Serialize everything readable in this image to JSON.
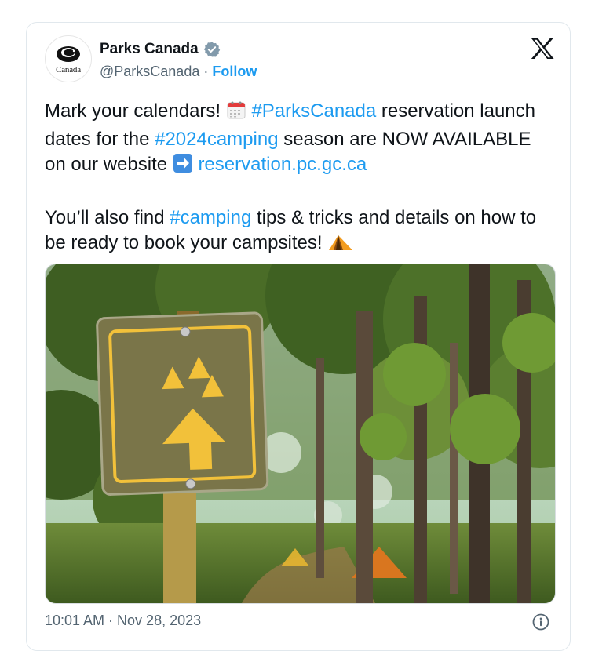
{
  "account": {
    "display_name": "Parks Canada",
    "handle": "@ParksCanada",
    "separator": " · ",
    "follow_label": "Follow",
    "verified": true,
    "avatar_wordmark": "Canada"
  },
  "tweet": {
    "line1_a": "Mark your calendars! ",
    "hashtag1": "#ParksCanada",
    "line1_b": " reservation launch dates for the ",
    "hashtag2": "#2024camping",
    "line1_c": " season are NOW AVAILABLE on our website ",
    "link": "reservation.pc.gc.ca",
    "line2_a": "You’ll also find ",
    "hashtag3": "#camping",
    "line2_b": " tips & tricks and details on how to be ready to book your campsites! "
  },
  "icons": {
    "calendar": "calendar-emoji",
    "arrow": "right-arrow-emoji",
    "tent": "tent-emoji",
    "platform": "x-logo-icon",
    "info": "info-icon"
  },
  "photo": {
    "subject": "campground-sign-photo"
  },
  "meta": {
    "timestamp": "10:01 AM · Nov 28, 2023"
  },
  "colors": {
    "link": "#1d9bf0",
    "text": "#0f1419",
    "muted": "#536471",
    "sign": "#7a7549",
    "sign_symbol": "#f2c13a"
  }
}
